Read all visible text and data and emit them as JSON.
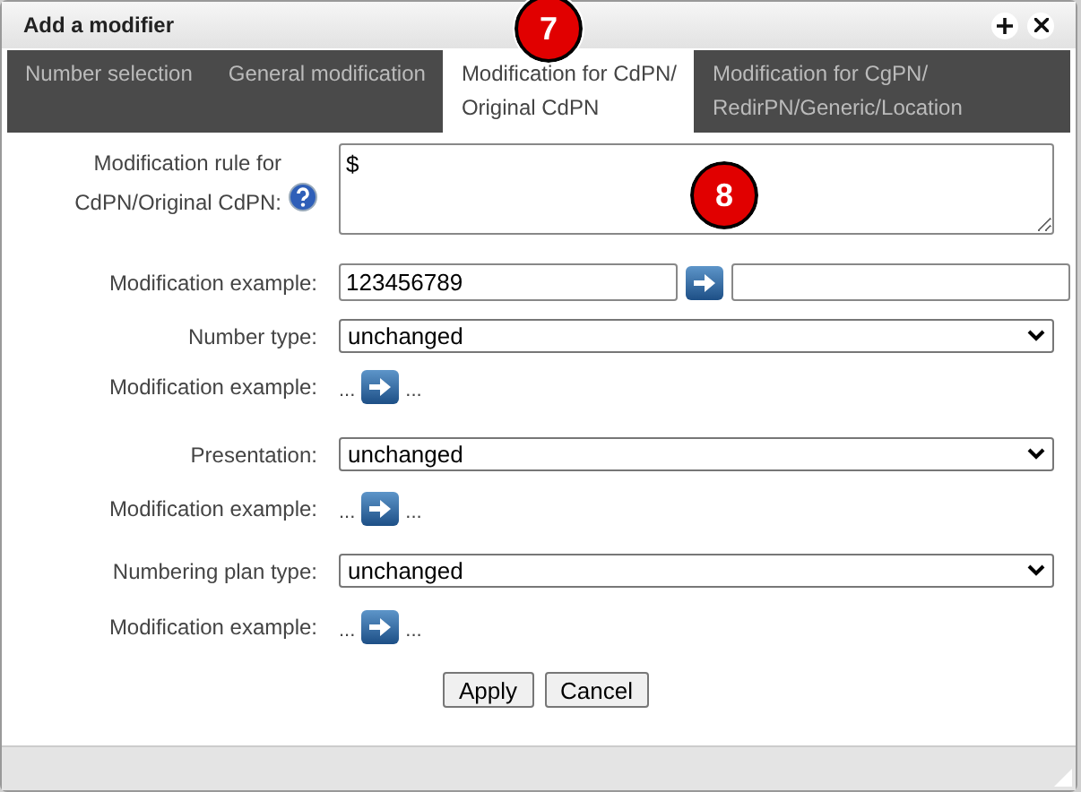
{
  "window": {
    "title": "Add a modifier"
  },
  "tabs": [
    {
      "label": "Number selection",
      "selected": false
    },
    {
      "label": "General modification",
      "selected": false
    },
    {
      "label": "Modification for CdPN/\nOriginal CdPN",
      "selected": true
    },
    {
      "label": "Modification for CgPN/\nRedirPN/Generic/Location",
      "selected": false
    }
  ],
  "form": {
    "rows": [
      {
        "kind": "textarea",
        "label": "Modification rule for CdPN/Original CdPN:",
        "value": "$"
      },
      {
        "kind": "example-input",
        "label": "Modification example:",
        "value": "123456789"
      },
      {
        "kind": "select",
        "label": "Number type:",
        "value": "unchanged"
      },
      {
        "kind": "example-dots",
        "label": "Modification example:",
        "before": "...",
        "after": "..."
      },
      {
        "kind": "select",
        "label": "Presentation:",
        "value": "unchanged"
      },
      {
        "kind": "example-dots",
        "label": "Modification example:",
        "before": "...",
        "after": "..."
      },
      {
        "kind": "select",
        "label": "Numbering plan type:",
        "value": "unchanged"
      },
      {
        "kind": "example-dots",
        "label": "Modification example:",
        "before": "...",
        "after": "..."
      }
    ],
    "buttons": [
      "Apply",
      "Cancel"
    ]
  },
  "markers": [
    "7",
    "8"
  ]
}
